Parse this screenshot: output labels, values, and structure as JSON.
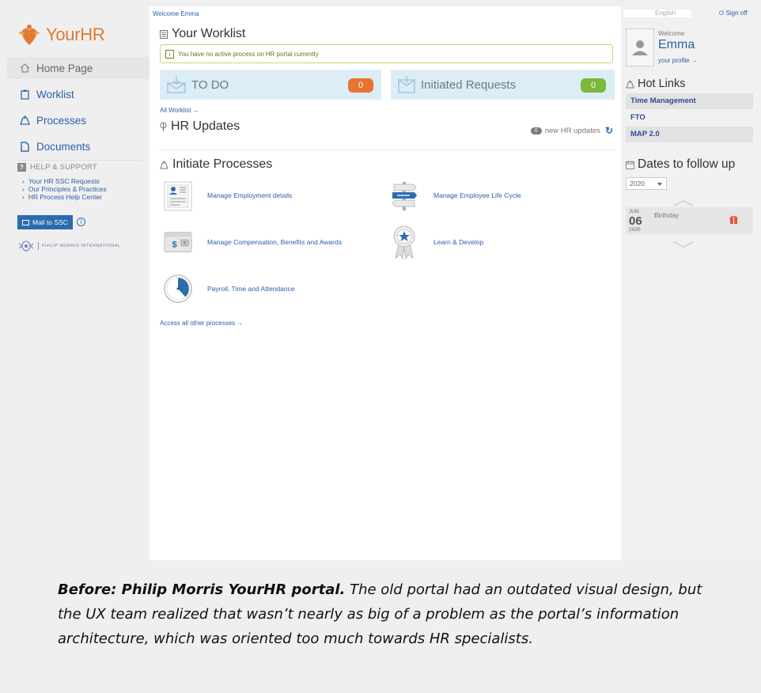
{
  "topbar": {
    "welcome_user": "Welcome Emma",
    "language": "English",
    "sign_off": "Sign off"
  },
  "sidebar": {
    "logo_text": "YourHR",
    "items": [
      {
        "label": "Home Page",
        "icon": "home-icon"
      },
      {
        "label": "Worklist",
        "icon": "clipboard-icon"
      },
      {
        "label": "Processes",
        "icon": "processes-icon"
      },
      {
        "label": "Documents",
        "icon": "document-icon"
      }
    ],
    "help_title": "HELP & SUPPORT",
    "help_links": [
      "Your HR SSC Requests",
      "Our Principles & Practices",
      "HR Process Help Center"
    ],
    "mail_button": "Mail to SSC",
    "company_name": "PHILIP MORRIS INTERNATIONAL"
  },
  "main": {
    "worklist_title": "Your Worklist",
    "notice": "You have no active process on HR portal currently",
    "todo_label": "TO DO",
    "todo_count": "0",
    "initiated_label": "Initiated Requests",
    "initiated_count": "0",
    "all_worklist_link": "All Worklist →",
    "updates_title": "HR Updates",
    "updates_count": "0",
    "updates_text": "new HR updates",
    "initiate_title": "Initiate Processes",
    "processes": [
      {
        "label": "Manage Employment details",
        "icon": "employment-card-icon"
      },
      {
        "label": "Manage Employee Life Cycle",
        "icon": "signpost-icon"
      },
      {
        "label": "Manage Compensation, Benefits and Awards",
        "icon": "wallet-icon"
      },
      {
        "label": "Learn & Develop",
        "icon": "award-ribbon-icon"
      },
      {
        "label": "Payroll, Time and Attendance",
        "icon": "clock-icon"
      }
    ],
    "all_processes_link": "Access all other processes →"
  },
  "right": {
    "welcome": "Welcome",
    "user_name": "Emma",
    "profile_link": "your profile →",
    "hot_links_title": "Hot Links",
    "hot_links": [
      "Time Management",
      "FTO",
      "MAP 2.0"
    ],
    "dates_title": "Dates to follow up",
    "year": "2020",
    "event": {
      "month": "JUN",
      "day": "06",
      "year": "2020",
      "name": "Birthday"
    }
  },
  "caption": {
    "bold": "Before: Philip Morris YourHR portal.",
    "text": " The old portal had an outdated visual design, but the UX team realized that wasn’t nearly as big of a problem as the portal’s information architecture, which was oriented too much towards HR specialists."
  },
  "colors": {
    "brand_orange": "#e07a2e",
    "link_blue": "#2b5fa6",
    "todo_badge": "#e8742f",
    "initiated_badge": "#7cb83b",
    "tile_bg": "#dcedf6"
  }
}
